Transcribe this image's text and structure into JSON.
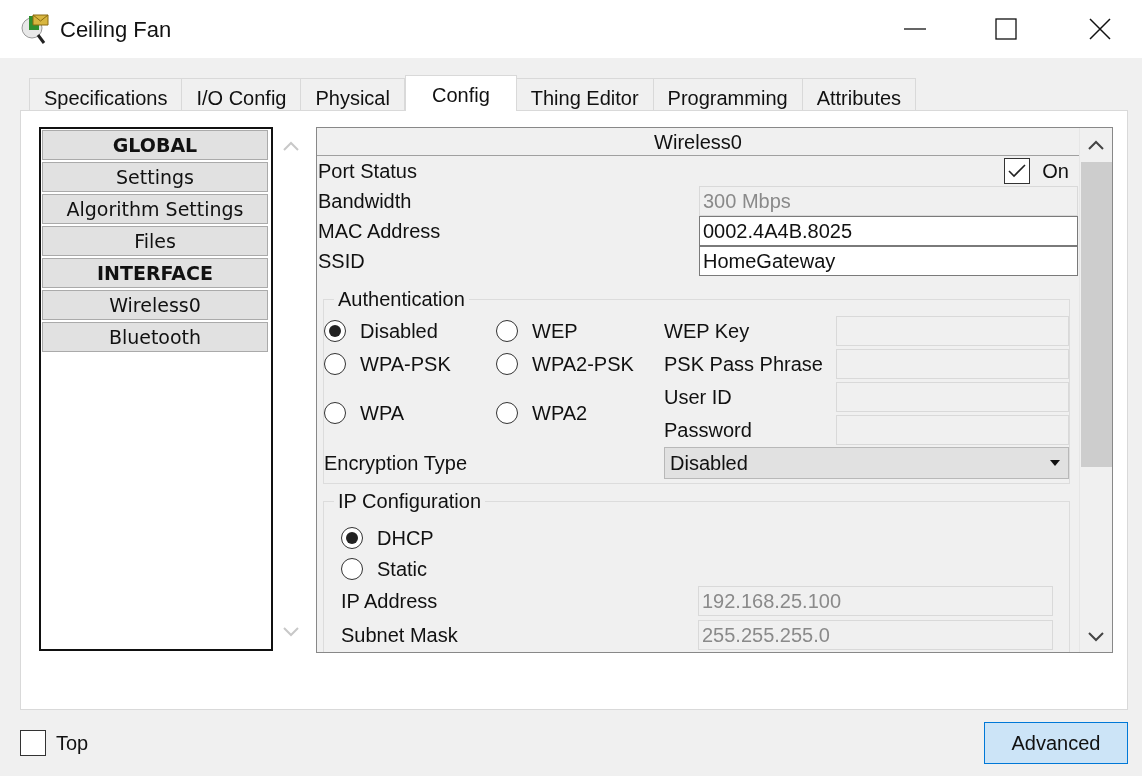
{
  "window": {
    "title": "Ceiling Fan"
  },
  "tabs": [
    {
      "label": "Specifications",
      "selected": false
    },
    {
      "label": "I/O Config",
      "selected": false
    },
    {
      "label": "Physical",
      "selected": false
    },
    {
      "label": "Config",
      "selected": true
    },
    {
      "label": "Thing Editor",
      "selected": false
    },
    {
      "label": "Programming",
      "selected": false
    },
    {
      "label": "Attributes",
      "selected": false
    }
  ],
  "sidebar": {
    "items": [
      {
        "label": "GLOBAL",
        "kind": "header"
      },
      {
        "label": "Settings",
        "kind": "item"
      },
      {
        "label": "Algorithm Settings",
        "kind": "item"
      },
      {
        "label": "Files",
        "kind": "item"
      },
      {
        "label": "INTERFACE",
        "kind": "header"
      },
      {
        "label": "Wireless0",
        "kind": "item"
      },
      {
        "label": "Bluetooth",
        "kind": "item"
      }
    ]
  },
  "panel": {
    "title": "Wireless0",
    "port_status": {
      "label": "Port Status",
      "checked": true,
      "text": "On"
    },
    "fields": [
      {
        "label": "Bandwidth",
        "value": "300 Mbps",
        "disabled": true
      },
      {
        "label": "MAC Address",
        "value": "0002.4A4B.8025",
        "disabled": false
      },
      {
        "label": "SSID",
        "value": "HomeGateway",
        "disabled": false
      }
    ],
    "authentication": {
      "title": "Authentication",
      "options": [
        {
          "label": "Disabled",
          "selected": true
        },
        {
          "label": "WEP",
          "selected": false
        },
        {
          "label": "WPA-PSK",
          "selected": false
        },
        {
          "label": "WPA2-PSK",
          "selected": false
        },
        {
          "label": "WPA",
          "selected": false
        },
        {
          "label": "WPA2",
          "selected": false
        }
      ],
      "fields": [
        {
          "label": "WEP Key",
          "disabled": true
        },
        {
          "label": "PSK Pass Phrase",
          "disabled": true
        },
        {
          "label": "User ID",
          "disabled": true
        },
        {
          "label": "Password",
          "disabled": true
        }
      ],
      "encryption": {
        "label": "Encryption Type",
        "value": "Disabled"
      }
    },
    "ip_configuration": {
      "title": "IP Configuration",
      "options": [
        {
          "label": "DHCP",
          "selected": true
        },
        {
          "label": "Static",
          "selected": false
        }
      ],
      "fields": [
        {
          "label": "IP Address",
          "value": "192.168.25.100",
          "disabled": true
        },
        {
          "label": "Subnet Mask",
          "value": "255.255.255.0",
          "disabled": true
        }
      ]
    }
  },
  "top_checkbox": {
    "label": "Top",
    "checked": false
  },
  "buttons": [
    {
      "label": "Advanced"
    }
  ]
}
